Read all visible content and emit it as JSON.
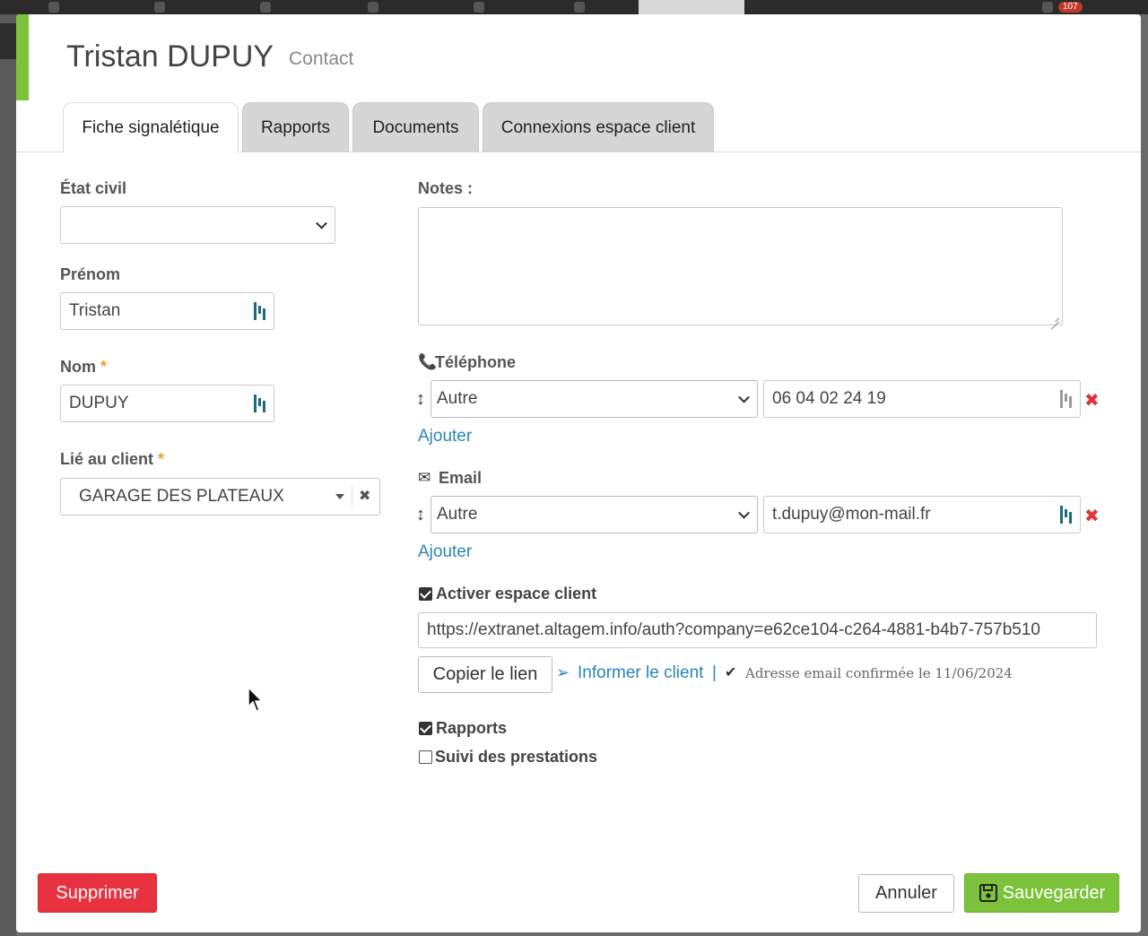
{
  "background": {
    "notification_count": "107"
  },
  "modal": {
    "title": "Tristan DUPUY",
    "subtitle": "Contact",
    "tabs": [
      {
        "label": "Fiche signalétique",
        "active": true
      },
      {
        "label": "Rapports",
        "active": false
      },
      {
        "label": "Documents",
        "active": false
      },
      {
        "label": "Connexions espace client",
        "active": false
      }
    ]
  },
  "form": {
    "etat_civil": {
      "label": "État civil",
      "value": ""
    },
    "prenom": {
      "label": "Prénom",
      "value": "Tristan"
    },
    "nom": {
      "label": "Nom",
      "required_mark": "*",
      "value": "DUPUY"
    },
    "client": {
      "label": "Lié au client",
      "required_mark": "*",
      "value": "GARAGE DES PLATEAUX"
    },
    "notes": {
      "label": "Notes :",
      "value": ""
    },
    "telephone": {
      "label": "Téléphone",
      "type": "Autre",
      "value": "06 04 02 24 19",
      "add_label": "Ajouter"
    },
    "email": {
      "label": "Email",
      "type": "Autre",
      "value": "t.dupuy@mon-mail.fr",
      "add_label": "Ajouter"
    },
    "espace_client": {
      "label": "Activer espace client",
      "checked": true,
      "url": "https://extranet.altagem.info/auth?company=e62ce104-c264-4881-b4b7-757b510",
      "copy_label": "Copier le lien",
      "inform_label": "Informer le client",
      "separator": "|",
      "confirmed_text": "Adresse email confirmée le 11/06/2024"
    },
    "rapports": {
      "label": "Rapports",
      "checked": true
    },
    "suivi": {
      "label": "Suivi des prestations",
      "checked": false
    }
  },
  "footer": {
    "delete_label": "Supprimer",
    "cancel_label": "Annuler",
    "save_label": "Sauvegarder"
  },
  "colors": {
    "accent": "#7cc23a",
    "danger": "#e8323f",
    "link": "#2a86b8"
  }
}
